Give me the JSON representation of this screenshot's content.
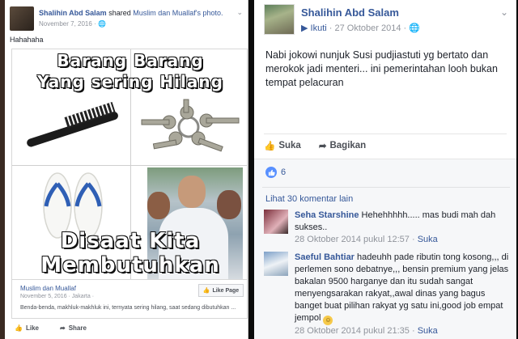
{
  "left_post": {
    "author": "Shalihin Abd Salam",
    "shared_text": "shared",
    "shared_link": "Muslim dan Muallaf's photo.",
    "date": "November 7, 2016",
    "audience_sep": "·",
    "caption": "Hahahaha",
    "meme": {
      "line1": "Barang Barang",
      "line2": "Yang sering Hilang",
      "line3": "Disaat Kita",
      "line4": "Membutuhkan"
    },
    "share_box": {
      "page_name": "Muslim dan Muallaf",
      "meta": "November 5, 2016 · Jakarta ·",
      "description": "Benda-benda, makhluk-makhluk ini, ternyata sering hilang, saat sedang dibutuhkan ...",
      "like_page_label": "Like Page"
    },
    "actions": {
      "like": "Like",
      "share": "Share"
    }
  },
  "right_post": {
    "author": "Shalihin Abd Salam",
    "follow_label": "Ikuti",
    "date": "27 Oktober 2014",
    "text": "Nabi jokowi nunjuk Susi pudjiastuti yg bertato dan merokok jadi menteri... ini pemerintahan looh bukan tempat pelacuran",
    "actions": {
      "like": "Suka",
      "share": "Bagikan"
    },
    "reaction_count": "6",
    "more_comments": "Lihat 30 komentar lain",
    "comments": [
      {
        "name": "Seha Starshine",
        "text": "Hehehhhhh..... mas budi mah dah sukses..",
        "date": "28 Oktober 2014 pukul 12:57",
        "like": "Suka"
      },
      {
        "name": "Saeful Bahtiar",
        "text": "hadeuhh pade ributin tong kosong,,, di perlemen sono debatnye,,, bensin premium yang jelas bakalan 9500 harganye dan itu sudah sangat menyengsarakan rakyat,,awal dinas yang bagus banget buat pilihan rakyat yg satu ini,good job empat jempol",
        "emoji": "smile-emoji",
        "date": "28 Oktober 2014 pukul 21:35",
        "like": "Suka"
      }
    ]
  },
  "colors": {
    "link": "#365899",
    "meta": "#90949c",
    "like_bubble": "#5890ff"
  }
}
